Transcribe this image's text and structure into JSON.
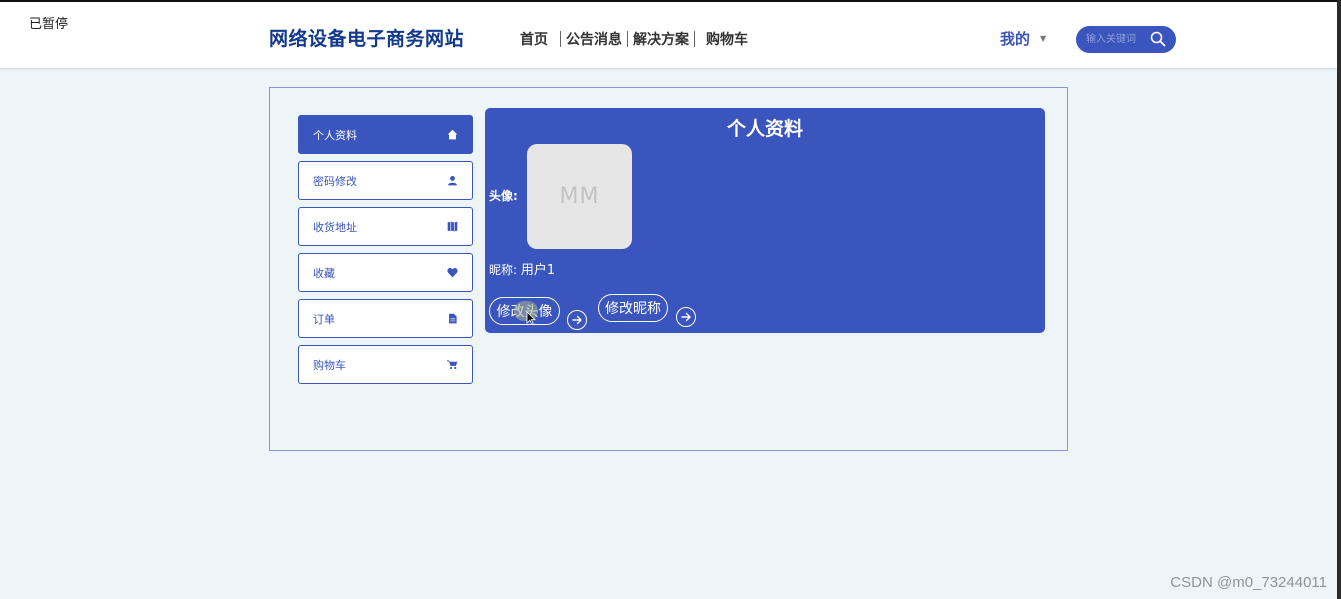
{
  "recording_label": "已暂停",
  "header": {
    "site_title": "网络设备电子商务网站",
    "nav": [
      "首页",
      "公告消息",
      "解决方案",
      "购物车"
    ],
    "user_menu_label": "我的",
    "search_placeholder": "输入关键词"
  },
  "sidebar": {
    "items": [
      {
        "label": "个人资料",
        "icon": "home-icon",
        "active": true
      },
      {
        "label": "密码修改",
        "icon": "user-icon",
        "active": false
      },
      {
        "label": "收货地址",
        "icon": "map-icon",
        "active": false
      },
      {
        "label": "收藏",
        "icon": "heart-icon",
        "active": false
      },
      {
        "label": "订单",
        "icon": "file-icon",
        "active": false
      },
      {
        "label": "购物车",
        "icon": "cart-icon",
        "active": false
      }
    ]
  },
  "profile": {
    "title": "个人资料",
    "avatar_label": "头像:",
    "avatar_initials": "MM",
    "nickname_label": "昵称:",
    "nickname_value": "用户1",
    "change_avatar_button": "修改头像",
    "change_nickname_button": "修改昵称"
  },
  "watermark": "CSDN @m0_73244011",
  "colors": {
    "primary": "#3a55bd",
    "page_background": "#eef5f8",
    "title": "#123a8c"
  }
}
